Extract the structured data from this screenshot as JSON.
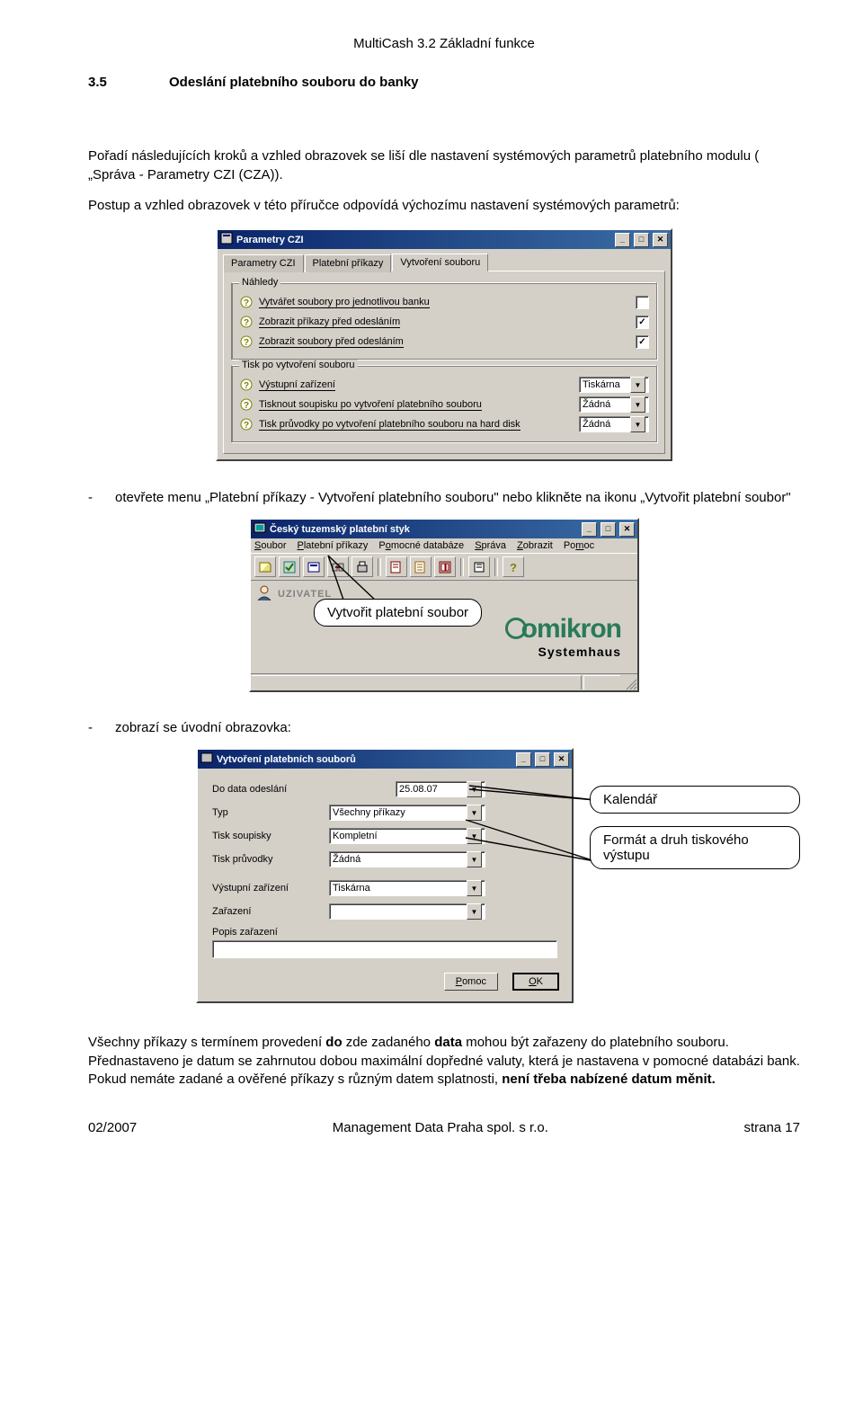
{
  "header": {
    "title": "MultiCash 3.2 Základní funkce"
  },
  "section": {
    "num": "3.5",
    "title": "Odeslání platebního souboru do banky"
  },
  "para1": "Pořadí následujících kroků a vzhled obrazovek se liší dle nastavení systémových parametrů platebního modulu ( „Správa - Parametry CZI (CZA)).",
  "para2": "Postup a vzhled obrazovek v této příručce odpovídá výchozímu nastavení systémových parametrů:",
  "dlg1": {
    "title": "Parametry CZI",
    "tabs": [
      "Parametry CZI",
      "Platební příkazy",
      "Vytvoření souboru"
    ],
    "group_nahledy": "Náhledy",
    "row_vytvaret": "Vytvářet soubory pro jednotlivou banku",
    "row_zobrazit_prikazy": "Zobrazit příkazy před odesláním",
    "row_zobrazit_soubory": "Zobrazit soubory před odesláním",
    "group_tisk": "Tisk po vytvoření souboru",
    "row_vystup": "Výstupní zařízení",
    "val_vystup": "Tiskárna",
    "row_soupiska": "Tisknout soupisku po vytvoření platebního souboru",
    "val_zadna1": "Žádná",
    "row_pruvodka": "Tisk průvodky po vytvoření platebního souboru na hard disk",
    "val_zadna2": "Žádná"
  },
  "bullet1": "otevřete menu „Platební příkazy - Vytvoření platebního souboru\" nebo klikněte na ikonu „Vytvořit platební soubor\"",
  "app": {
    "title": "Český tuzemský platební styk",
    "menu": [
      "Soubor",
      "Platební příkazy",
      "Pomocné databáze",
      "Správa",
      "Zobrazit",
      "Pomoc"
    ],
    "user": "UZIVATEL",
    "logo": "omikron",
    "systemhaus": "Systemhaus"
  },
  "callouts": {
    "vytvorit": "Vytvořit platební soubor",
    "kalendar": "Kalendář",
    "format": "Formát a druh tiskového výstupu"
  },
  "bullet2": "zobrazí se úvodní obrazovka:",
  "dlg2": {
    "title": "Vytvoření platebních souborů",
    "lbl_datum": "Do data odeslání",
    "val_datum": "25.08.07",
    "lbl_typ": "Typ",
    "val_typ": "Všechny příkazy",
    "lbl_soupisky": "Tisk soupisky",
    "val_soupisky": "Kompletní",
    "lbl_pruvodky": "Tisk průvodky",
    "val_pruvodky": "Žádná",
    "lbl_vystup": "Výstupní zařízení",
    "val_vystup": "Tiskárna",
    "lbl_zarazeni": "Zařazení",
    "val_zarazeni": "",
    "lbl_popis": "Popis zařazení",
    "val_popis": "",
    "btn_pomoc": "Pomoc",
    "btn_ok": "OK"
  },
  "para3a": "Všechny příkazy s termínem provedení ",
  "para3b": "do",
  "para3c": " zde zadaného ",
  "para3d": "data",
  "para3e": " mohou být zařazeny do platebního souboru. Přednastaveno je datum se zahrnutou dobou maximální dopředné valuty, která je nastavena v pomocné databázi bank. Pokud nemáte zadané a ověřené  příkazy s různým datem splatnosti, ",
  "para3f": "není třeba nabízené datum měnit.",
  "footer": {
    "left": "02/2007",
    "center": "Management Data Praha spol. s r.o.",
    "right": "strana 17"
  }
}
